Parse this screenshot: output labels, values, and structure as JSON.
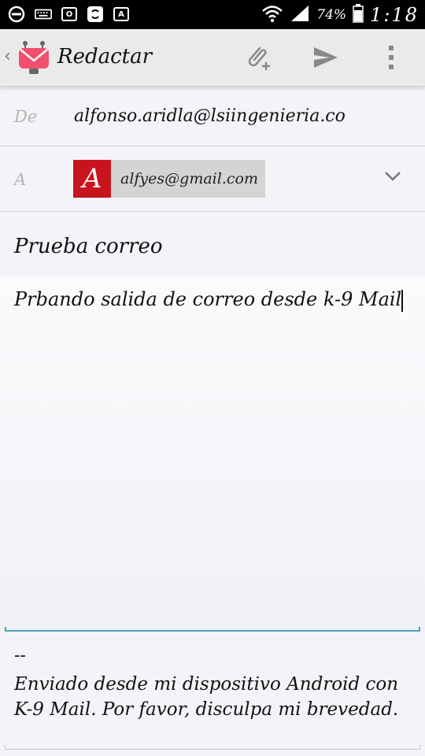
{
  "status_bar": {
    "battery": "74%",
    "time": "1:18",
    "icons": [
      "do-not-disturb-icon",
      "keyboard-icon",
      "outlook-icon",
      "sync-icon",
      "font-icon",
      "wifi-icon",
      "signal-icon",
      "battery-icon"
    ]
  },
  "action_bar": {
    "title": "Redactar",
    "icons": [
      "back-chevron-icon",
      "k9-mail-logo",
      "attach-icon",
      "send-icon",
      "overflow-menu-icon"
    ]
  },
  "from_field": {
    "label": "De",
    "value": "alfonso.aridla@lsiingenieria.co"
  },
  "to_field": {
    "label": "A",
    "recipients": [
      {
        "avatar_letter": "A",
        "email": "alfyes@gmail.com",
        "avatar_color": "#c8141c"
      }
    ]
  },
  "subject": "Prueba correo",
  "body": "Prbando salida de correo desde k-9 Mail",
  "signature": {
    "separator": "--",
    "text": "Enviado desde mi dispositivo Android con K-9 Mail. Por favor, disculpa mi brevedad."
  },
  "colors": {
    "accent": "#4fa4b3",
    "avatar": "#c8141c",
    "action_bar": "#eaeaea"
  }
}
